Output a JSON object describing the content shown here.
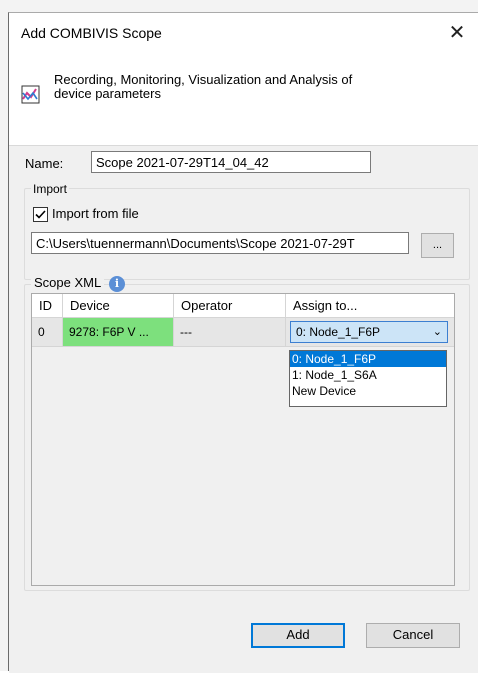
{
  "dialog": {
    "title": "Add COMBIVIS Scope",
    "close_icon": "close-icon",
    "header_icon": "chart-icon",
    "description_line1": "Recording, Monitoring, Visualization and Analysis of",
    "description_line2": "device parameters"
  },
  "name": {
    "label": "Name:",
    "value": "Scope 2021-07-29T14_04_42"
  },
  "import": {
    "legend": "Import",
    "checkbox_label": "Import from file",
    "checked": true,
    "path": "C:\\Users\\tuennermann\\Documents\\Scope 2021-07-29T",
    "browse_label": "..."
  },
  "scope_xml": {
    "legend": "Scope XML",
    "info_icon": "info-icon",
    "columns": [
      "ID",
      "Device",
      "Operator",
      "Assign to..."
    ],
    "rows": [
      {
        "id": "0",
        "device": "9278: F6P V ...",
        "operator": "---",
        "assign": "0: Node_1_F6P"
      }
    ],
    "device_highlight_color": "#7de07d",
    "dropdown_options": [
      "0: Node_1_F6P",
      "1: Node_1_S6A",
      "New Device"
    ],
    "dropdown_selected": "0: Node_1_F6P"
  },
  "buttons": {
    "add": "Add",
    "cancel": "Cancel"
  }
}
